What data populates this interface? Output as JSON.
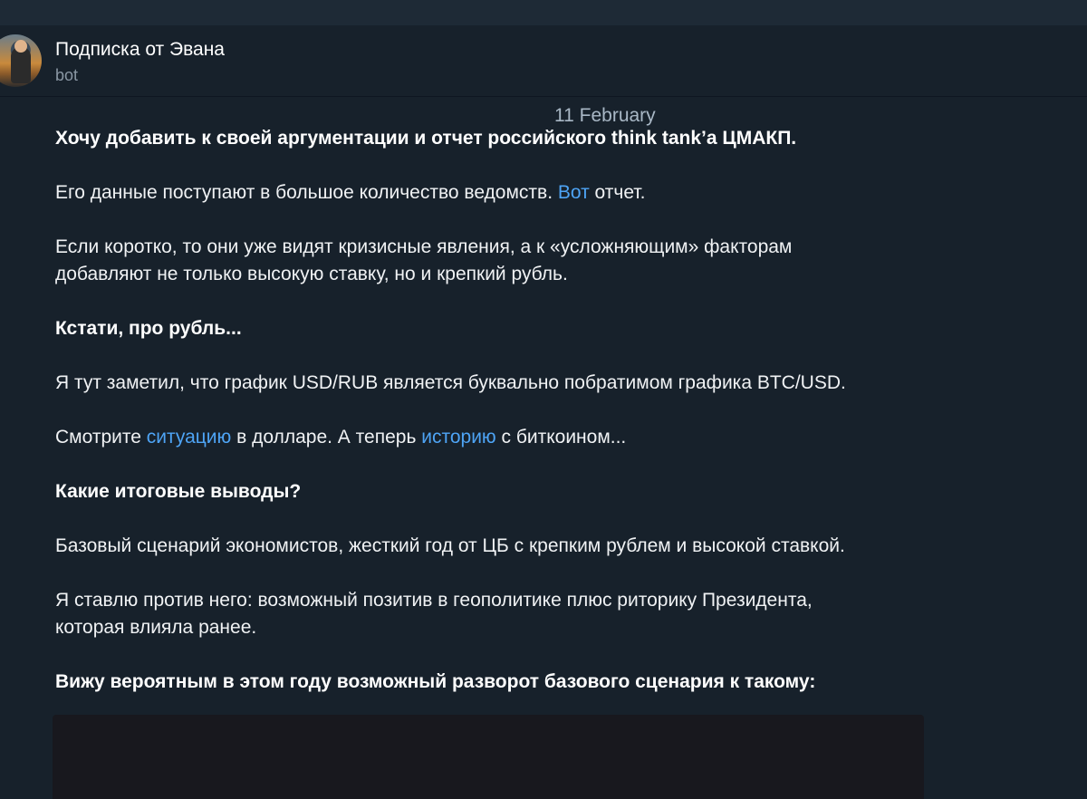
{
  "chat": {
    "title": "Подписка от Эвана",
    "subtitle": "bot"
  },
  "date_separator": "11 February",
  "message": {
    "p1": "Хочу добавить к своей аргументации и отчет российского think tank’а ЦМАКП.",
    "p2_before": "Его данные поступают в большое количество ведомств. ",
    "p2_link": "Вот",
    "p2_after": " отчет.",
    "p3_line1": "Если коротко, то они уже видят кризисные явления, а к «усложняющим» факторам",
    "p3_line2": "добавляют не только высокую ставку, но и крепкий рубль.",
    "p4": "Кстати, про рубль...",
    "p5": "Я тут заметил, что график USD/RUB является буквально побратимом графика BTC/USD.",
    "p6_before": "Смотрите ",
    "p6_link1": "ситуацию",
    "p6_mid": " в долларе. А теперь ",
    "p6_link2": "историю",
    "p6_after": " с биткоином...",
    "p7": "Какие итоговые выводы?",
    "p8": "Базовый сценарий экономистов, жесткий год от ЦБ с крепким рублем и высокой ставкой.",
    "p9_line1": "Я ставлю против него: возможный позитив в геополитике плюс риторику Президента,",
    "p9_line2": "которая влияла ранее.",
    "p10": "Вижу вероятным в этом году возможный разворот базового сценария к такому:"
  },
  "colors": {
    "background": "#17212b",
    "link": "#4ea4f5",
    "subtitle": "#8a97a4"
  }
}
